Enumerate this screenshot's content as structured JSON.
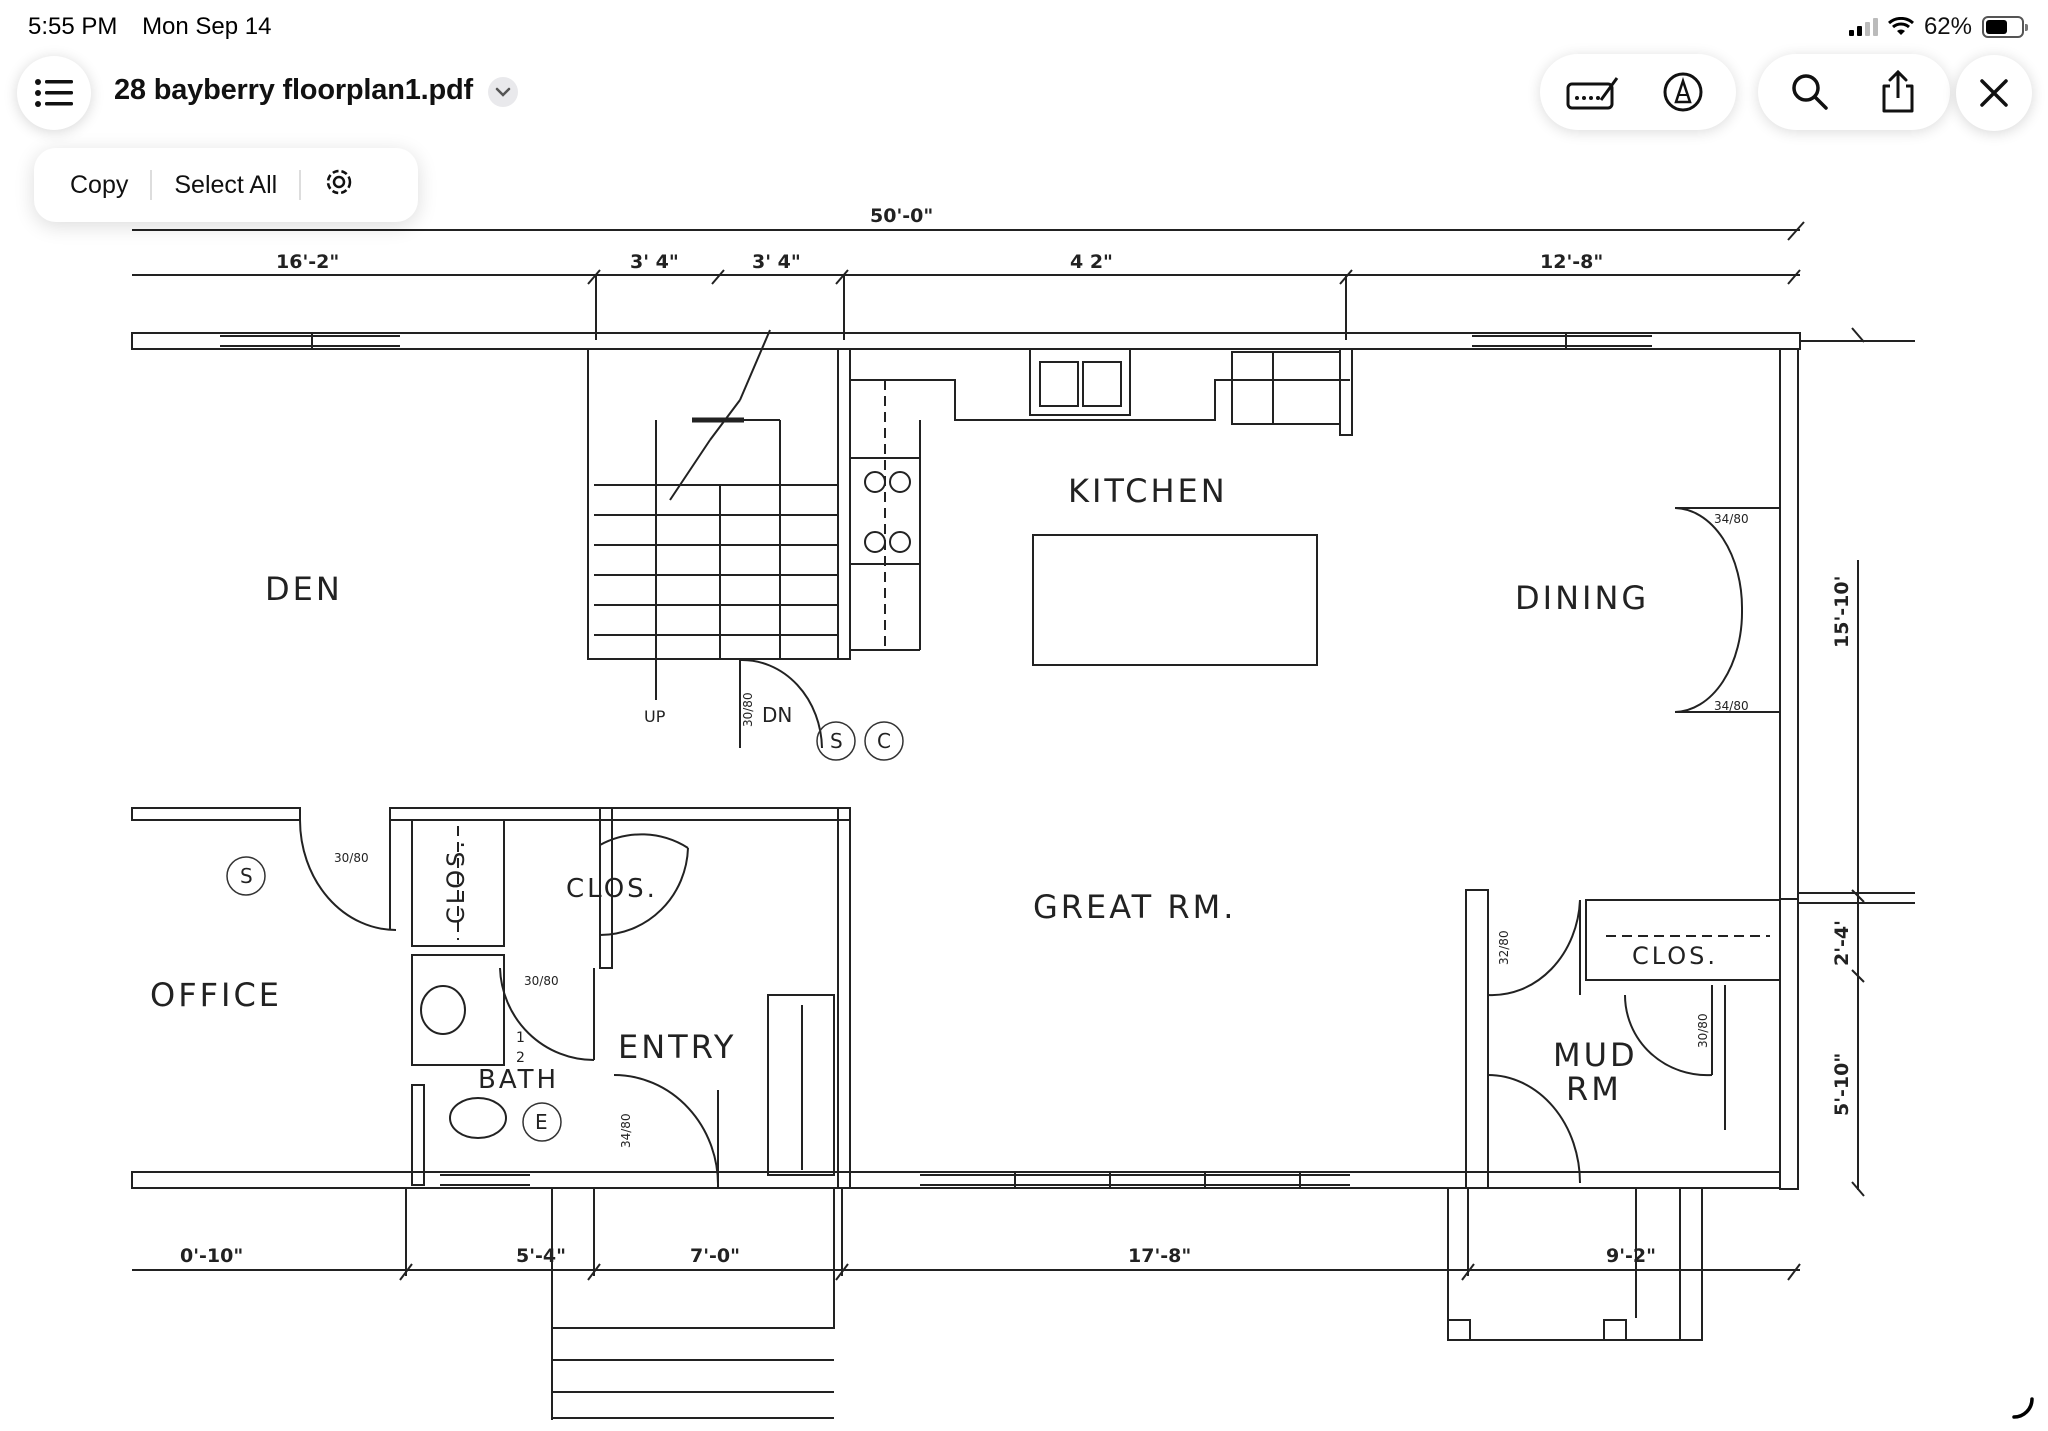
{
  "status_bar": {
    "time": "5:55 PM",
    "date": "Mon Sep 14",
    "battery_percent": "62%",
    "battery_level": 0.62
  },
  "document": {
    "title": "28 bayberry floorplan1.pdf"
  },
  "edit_menu": {
    "copy": "Copy",
    "select_all": "Select All"
  },
  "icons": {
    "sidebar": "list-icon",
    "title_menu": "chevron-down-icon",
    "annotate": "signature-icon",
    "markup": "markup-pen-icon",
    "search": "magnifier-icon",
    "share": "share-icon",
    "close": "close-x-icon",
    "lookup": "visual-lookup-icon"
  },
  "plan": {
    "rooms": {
      "den": "DEN",
      "kitchen": "KITCHEN",
      "dining": "DINING",
      "great_rm": "GREAT  RM.",
      "office": "OFFICE",
      "entry": "ENTRY",
      "bath": "BATH",
      "half": "1",
      "half_den": "2",
      "mud": "MUD",
      "mud_rm": "RM",
      "clos_left": "CLOS.",
      "clos_mid": "CLOS.",
      "clos_mud": "CLOS.",
      "up": "UP",
      "dn": "DN"
    },
    "symbols": {
      "s1": "S",
      "c1": "C",
      "s2": "S",
      "e1": "E"
    },
    "dimensions": {
      "overall": "50'-0\"",
      "top_1": "16'-2\"",
      "top_2": "3' 4\"",
      "top_3": "3' 4\"",
      "top_4": "4  2\"",
      "top_5": "12'-8\"",
      "bot_1": "0'-10\"",
      "bot_2": "5'-4\"",
      "bot_3": "7'-0\"",
      "bot_4": "17'-8\"",
      "bot_5": "9'-2\"",
      "right_1": "15'-10'",
      "right_2": "2'-4'",
      "right_3": "5'-10\""
    },
    "door_labels": {
      "d1": "34/80",
      "d2": "34/80",
      "d3": "30/80",
      "d4": "30/80",
      "d5": "30/80",
      "d6": "32/80",
      "d7": "30/80",
      "d8": "34/80"
    }
  }
}
